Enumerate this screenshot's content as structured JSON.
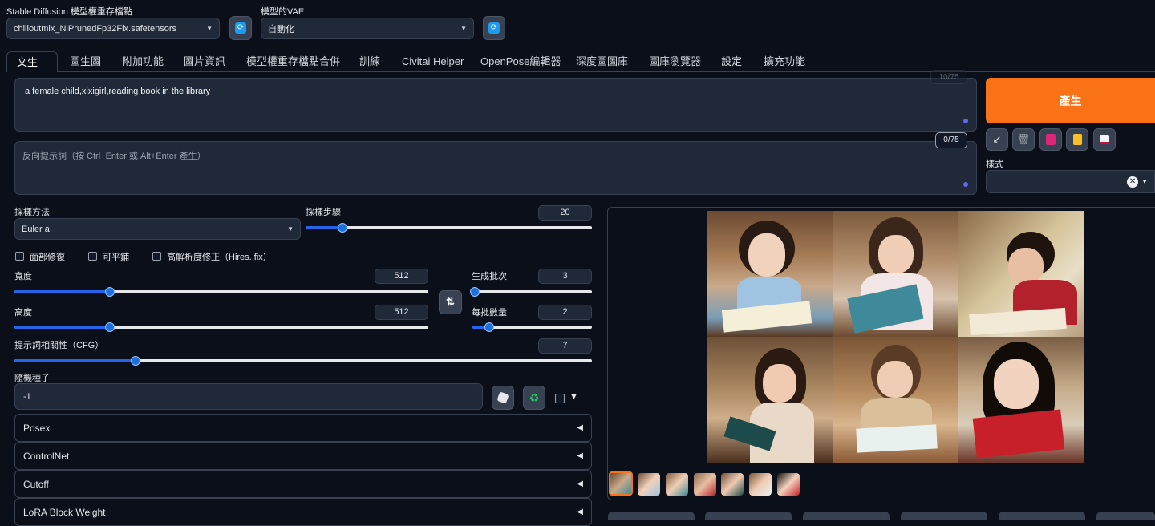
{
  "model": {
    "label": "Stable Diffusion 模型權重存檔點",
    "value": "chilloutmix_NiPrunedFp32Fix.safetensors"
  },
  "vae": {
    "label": "模型的VAE",
    "value": "自動化"
  },
  "icons": {
    "refresh": "refresh-icon",
    "swap": "swap-icon",
    "dice": "dice-icon",
    "recycle": "recycle-icon",
    "clear": "close-icon"
  },
  "tabs": [
    "文生圖",
    "圖生圖",
    "附加功能",
    "圖片資訊",
    "模型權重存檔點合併",
    "訓練",
    "Civitai Helper",
    "OpenPose編輯器",
    "深度圖圖庫",
    "圖庫瀏覽器",
    "設定",
    "擴充功能"
  ],
  "prompt": {
    "value": "a  female child,xixigirl,reading book in the library",
    "counter": "10/75"
  },
  "negative": {
    "placeholder": "反向提示詞（按 Ctrl+Enter 或 Alt+Enter 產生）",
    "counter": "0/75"
  },
  "generate_label": "產生",
  "style_label": "樣式",
  "sampler": {
    "label": "採樣方法",
    "value": "Euler a"
  },
  "steps": {
    "label": "採樣步驟",
    "value": "20",
    "fraction": 0.13
  },
  "checkboxes": {
    "restore_faces": "面部修復",
    "tiling": "可平鋪",
    "hires": "高解析度修正（Hires. fix）"
  },
  "width": {
    "label": "寬度",
    "value": "512",
    "fraction": 0.23
  },
  "height": {
    "label": "高度",
    "value": "512",
    "fraction": 0.23
  },
  "batch_count": {
    "label": "生成批次",
    "value": "3",
    "fraction": 0.02
  },
  "batch_size": {
    "label": "每批數量",
    "value": "2",
    "fraction": 0.14
  },
  "cfg": {
    "label": "提示詞相關性（CFG）",
    "value": "7",
    "fraction": 0.21
  },
  "seed": {
    "label": "隨機種子",
    "value": "-1"
  },
  "accordions": [
    "Posex",
    "ControlNet",
    "Cutoff",
    "LoRA Block Weight"
  ],
  "colors": {
    "accent": "#f97316",
    "background": "#0b0f19",
    "slider": "#2563eb"
  }
}
